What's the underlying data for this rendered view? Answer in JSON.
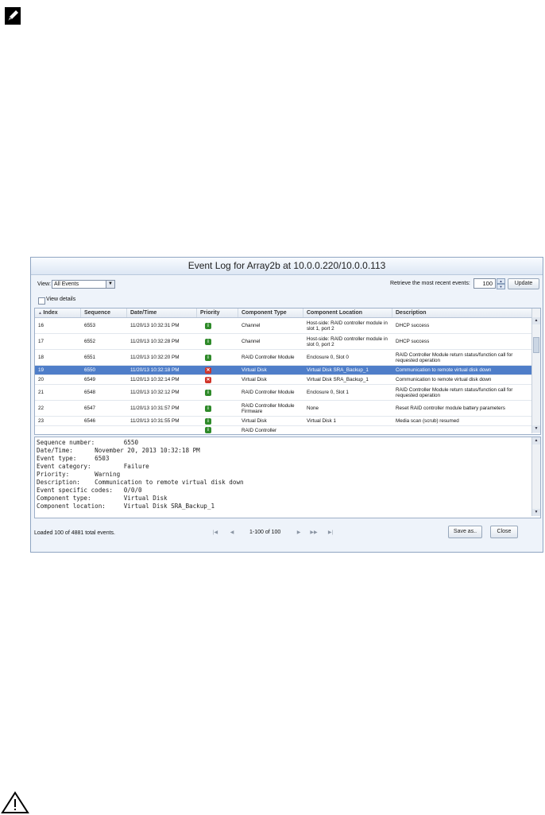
{
  "colors": {
    "selected_row": "#4f7ec9",
    "info": "#2f8a2a",
    "error": "#d0362b"
  },
  "window": {
    "title": "Event Log for Array2b at 10.0.0.220/10.0.0.113"
  },
  "toolbar": {
    "view_label": "View:",
    "view_value": "All Events",
    "retrieve_label": "Retrieve the most recent events:",
    "count_value": "100",
    "update_label": "Update",
    "view_details_label": "View details"
  },
  "table": {
    "columns": [
      "Index",
      "Sequence",
      "Date/Time",
      "Priority",
      "Component Type",
      "Component Location",
      "Description"
    ],
    "rows": [
      {
        "index": "16",
        "sequence": "6553",
        "datetime": "11/20/13 10:32:31 PM",
        "priority": "info",
        "component_type": "Channel",
        "component_location": "Host-side: RAID controller module in slot 1, port 2",
        "description": "DHCP success"
      },
      {
        "index": "17",
        "sequence": "6552",
        "datetime": "11/20/13 10:32:28 PM",
        "priority": "info",
        "component_type": "Channel",
        "component_location": "Host-side: RAID controller module in slot 0, port 2",
        "description": "DHCP success"
      },
      {
        "index": "18",
        "sequence": "6551",
        "datetime": "11/20/13 10:32:20 PM",
        "priority": "info",
        "component_type": "RAID Controller Module",
        "component_location": "Enclosure 0, Slot 0",
        "description": "RAID Controller Module return status/function call for requested operation"
      },
      {
        "index": "19",
        "sequence": "6550",
        "datetime": "11/20/13 10:32:18 PM",
        "priority": "error",
        "component_type": "Virtual Disk",
        "component_location": "Virtual Disk SRA_Backup_1",
        "description": "Communication to remote virtual disk down"
      },
      {
        "index": "20",
        "sequence": "6549",
        "datetime": "11/20/13 10:32:14 PM",
        "priority": "error",
        "component_type": "Virtual Disk",
        "component_location": "Virtual Disk SRA_Backup_1",
        "description": "Communication to remote virtual disk down"
      },
      {
        "index": "21",
        "sequence": "6548",
        "datetime": "11/20/13 10:32:12 PM",
        "priority": "info",
        "component_type": "RAID Controller Module",
        "component_location": "Enclosure 0, Slot 1",
        "description": "RAID Controller Module return status/function call for requested operation"
      },
      {
        "index": "22",
        "sequence": "6547",
        "datetime": "11/20/13 10:31:57 PM",
        "priority": "info",
        "component_type": "RAID Controller Module Firmware",
        "component_location": "None",
        "description": "Reset RAID controller module battery parameters"
      },
      {
        "index": "23",
        "sequence": "6546",
        "datetime": "11/20/13 10:31:55 PM",
        "priority": "info",
        "component_type": "Virtual Disk",
        "component_location": "Virtual Disk 1",
        "description": "Media scan (scrub) resumed"
      },
      {
        "index": "",
        "sequence": "",
        "datetime": "",
        "priority": "info",
        "component_type": "RAID Controller",
        "component_location": "",
        "description": ""
      }
    ]
  },
  "details": {
    "lines": [
      "Sequence number:        6550",
      "Date/Time:      November 20, 2013 10:32:18 PM",
      "Event type:     6503",
      "Event category:         Failure",
      "Priority:       Warning",
      "Description:    Communication to remote virtual disk down",
      "Event specific codes:   0/0/0",
      "Component type:         Virtual Disk",
      "Component location:     Virtual Disk SRA_Backup_1"
    ]
  },
  "footer": {
    "status": "Loaded 100 of 4881 total events.",
    "page_range": "1-100 of 100",
    "save_label": "Save as..",
    "close_label": "Close"
  }
}
